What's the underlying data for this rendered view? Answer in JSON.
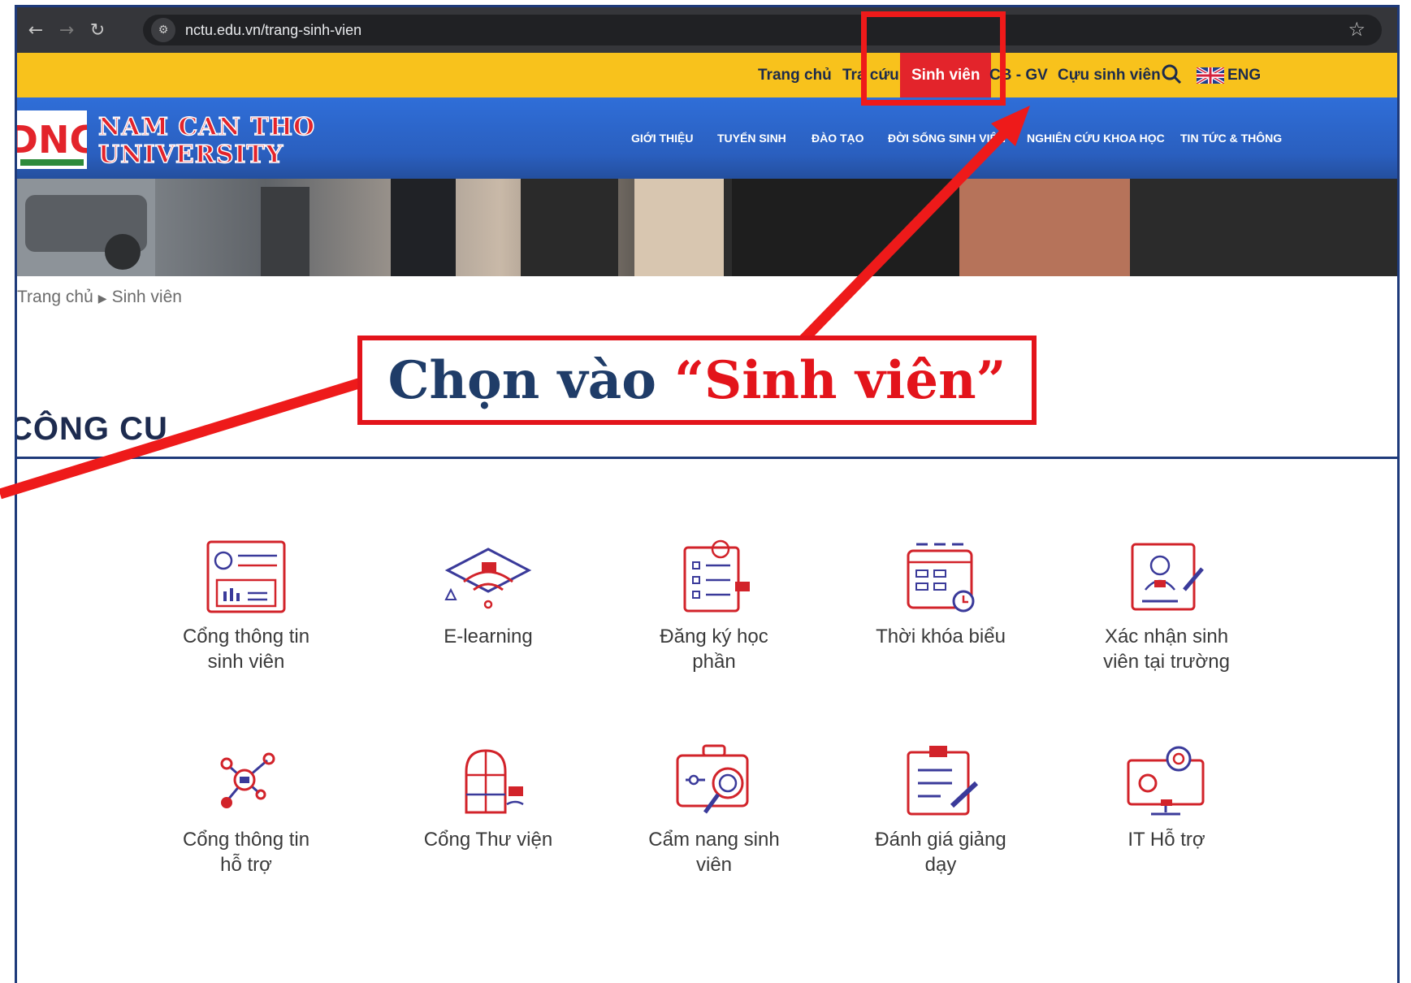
{
  "browser": {
    "url": "nctu.edu.vn/trang-sinh-vien"
  },
  "top_menu": {
    "items": [
      "Trang chủ",
      "Tra cứu",
      "Sinh viên",
      "CB - GV",
      "Cựu sinh viên"
    ],
    "lang": "ENG"
  },
  "header": {
    "logo_line1": "NAM CAN THO",
    "logo_line2": "UNIVERSITY",
    "nav": [
      "GIỚI THIỆU",
      "TUYỂN SINH",
      "ĐÀO TẠO",
      "ĐỜI SỐNG SINH VIÊN",
      "NGHIÊN CỨU KHOA HỌC",
      "TIN TỨC & THÔNG"
    ]
  },
  "breadcrumb": {
    "home": "Trang chủ",
    "separator": "▶",
    "current": "Sinh viên"
  },
  "section": {
    "title": "CÔNG CỤ"
  },
  "tools": [
    {
      "label1": "Cổng thông tin",
      "label2": "sinh viên",
      "icon": "student-portal-icon"
    },
    {
      "label1": "E-learning",
      "label2": "",
      "icon": "elearning-icon"
    },
    {
      "label1": "Đăng ký học",
      "label2": "phần",
      "icon": "course-registration-icon"
    },
    {
      "label1": "Thời khóa biểu",
      "label2": "",
      "icon": "timetable-icon"
    },
    {
      "label1": "Xác nhận sinh",
      "label2": "viên tại trường",
      "icon": "student-confirmation-icon"
    },
    {
      "label1": "Cổng thông tin",
      "label2": "hỗ trợ",
      "icon": "support-portal-icon"
    },
    {
      "label1": "Cổng Thư viện",
      "label2": "",
      "icon": "library-icon"
    },
    {
      "label1": "Cẩm nang sinh",
      "label2": "viên",
      "icon": "handbook-icon"
    },
    {
      "label1": "Đánh giá giảng",
      "label2": "dạy",
      "icon": "teaching-evaluation-icon"
    },
    {
      "label1": "IT Hỗ trợ",
      "label2": "",
      "icon": "it-support-icon"
    }
  ],
  "annotation": {
    "text": "Chọn vào ",
    "quoted": "“Sinh viên”"
  },
  "colors": {
    "accent_red": "#e3242b",
    "yellow_bar": "#f8c21c",
    "header_blue": "#2f6ed8",
    "navy": "#1d2b4f"
  }
}
